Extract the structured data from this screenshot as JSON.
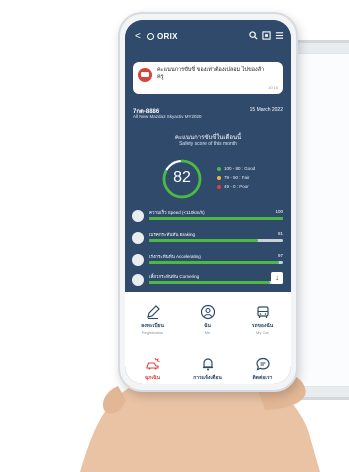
{
  "app": {
    "logo": "ORIX",
    "back_glyph": "<"
  },
  "notification": {
    "message": "คะแนนการขับขี่ ของเท่าต้องเปลอม ไปของส้าครู",
    "time": "10:16"
  },
  "car": {
    "plate": "7กด-8886",
    "model": "All New Mazda3 Skyactiv MY2020",
    "date": "15 March 2022"
  },
  "score": {
    "title": "คะแนนการขับขี่ในเดือนนี้",
    "subtitle": "Safety score of this month",
    "value": "82",
    "fraction": 0.82,
    "legend": [
      {
        "label": "100 - 80 : Good",
        "color": "#4bb944"
      },
      {
        "label": "79 - 50 : Fair",
        "color": "#f3b33d"
      },
      {
        "label": "49 - 0 : Poor",
        "color": "#e2413b"
      }
    ]
  },
  "metrics": [
    {
      "label": "ความเร็ว Speed (<110km/h)",
      "value": "100",
      "fraction": 1.0
    },
    {
      "label": "เบรคกระทันหัน Braking",
      "value": "81",
      "fraction": 0.81
    },
    {
      "label": "เร่งกระทันหัน Accelerating",
      "value": "97",
      "fraction": 0.97
    },
    {
      "label": "เลี้ยวกระทันหัน Cornering",
      "value": "",
      "fraction": 0.9
    }
  ],
  "menu": [
    {
      "label": "ลงทะเบียน",
      "sub": "Registration"
    },
    {
      "label": "ฉัน",
      "sub": "Me"
    },
    {
      "label": "รถของฉัน",
      "sub": "My Car"
    },
    {
      "label": "ฉุกเฉิน",
      "sub": ""
    },
    {
      "label": "การแจ้งเตือน",
      "sub": ""
    },
    {
      "label": "ติดต่อเรา",
      "sub": ""
    }
  ],
  "colors": {
    "primary": "#2f4a6a",
    "good": "#4bb944",
    "fair": "#f3b33d",
    "poor": "#e2413b",
    "emergency": "#e2413b"
  }
}
